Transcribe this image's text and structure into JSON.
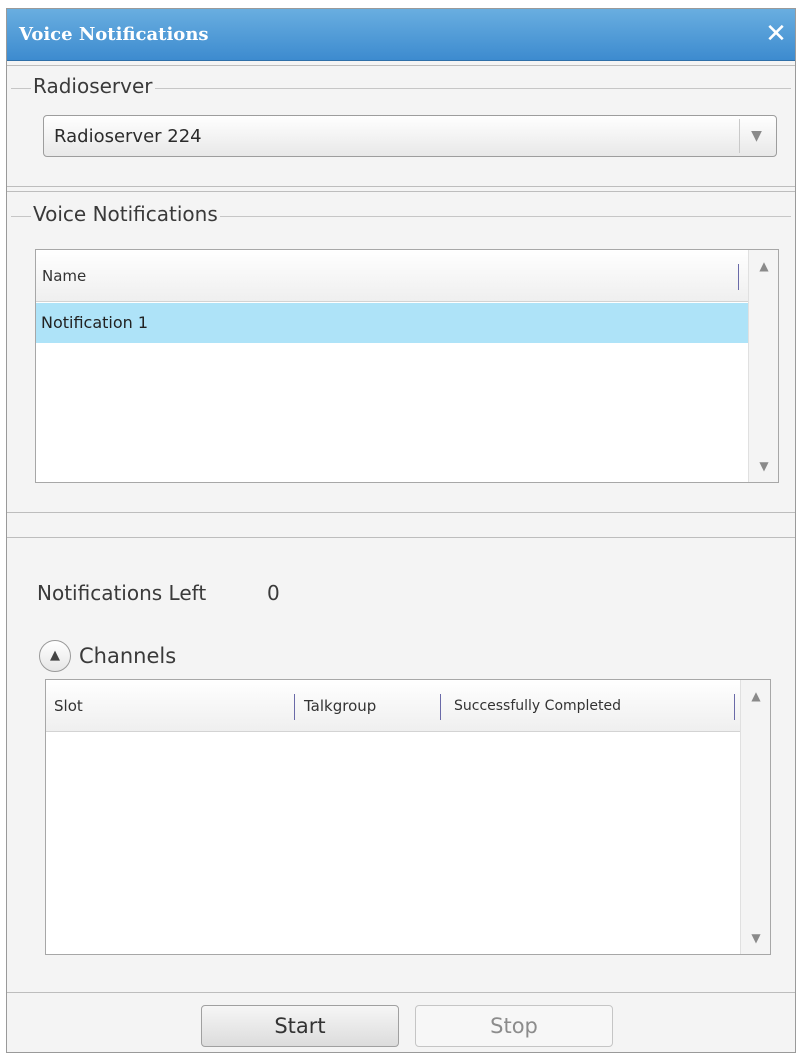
{
  "window": {
    "title": "Voice Notifications",
    "close_icon": "close-icon",
    "title_bar_color": "#4a97d8"
  },
  "radioserver": {
    "legend": "Radioserver",
    "selected": "Radioserver 224"
  },
  "voice_notifications": {
    "legend": "Voice Notifications",
    "columns": [
      "Name"
    ],
    "rows": [
      {
        "name": "Notification 1",
        "selected": true
      }
    ],
    "selected_color": "#aee3f8"
  },
  "status": {
    "notifications_left_label": "Notifications Left",
    "notifications_left_value": "0"
  },
  "channels": {
    "expander_label": "Channels",
    "expanded": true,
    "columns": [
      "Slot",
      "Talkgroup",
      "Successfully Completed"
    ],
    "rows": []
  },
  "buttons": {
    "start": "Start",
    "stop": "Stop"
  }
}
